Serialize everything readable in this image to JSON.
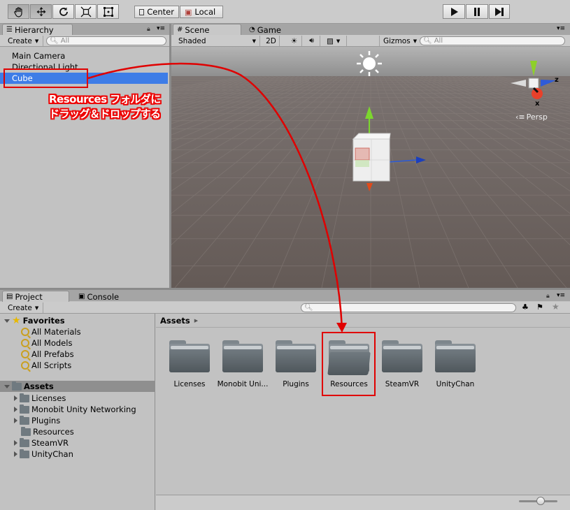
{
  "toolbar": {
    "tools": [
      "hand-tool",
      "move-tool",
      "rotate-tool",
      "scale-tool",
      "rect-tool"
    ],
    "pivot": "Center",
    "space": "Local"
  },
  "hierarchy": {
    "tab": "Hierarchy",
    "create": "Create",
    "search_placeholder": "All",
    "items": [
      "Main Camera",
      "Directional Light",
      "Cube"
    ]
  },
  "scene": {
    "tab_scene": "Scene",
    "tab_game": "Game",
    "shading": "Shaded",
    "mode_2d": "2D",
    "gizmos": "Gizmos",
    "search_placeholder": "All",
    "persp": "Persp",
    "axis_x": "x",
    "axis_z": "z"
  },
  "annotation": {
    "line1": "Resources フォルダに",
    "line2": "ドラッグ＆ドロップする"
  },
  "project": {
    "tab_project": "Project",
    "tab_console": "Console",
    "create": "Create",
    "favorites_label": "Favorites",
    "favorites": [
      "All Materials",
      "All Models",
      "All Prefabs",
      "All Scripts"
    ],
    "assets_label": "Assets",
    "assets_tree": [
      "Licenses",
      "Monobit Unity Networking",
      "Plugins",
      "Resources",
      "SteamVR",
      "UnityChan"
    ],
    "breadcrumb": "Assets",
    "folders": [
      "Licenses",
      "Monobit Uni...",
      "Plugins",
      "Resources",
      "SteamVR",
      "UnityChan"
    ]
  },
  "colors": {
    "selection": "#3e7de7",
    "annotation_red": "#e00000",
    "scene_ground": "#6b615d",
    "scene_sky": "#a9a9a9"
  }
}
